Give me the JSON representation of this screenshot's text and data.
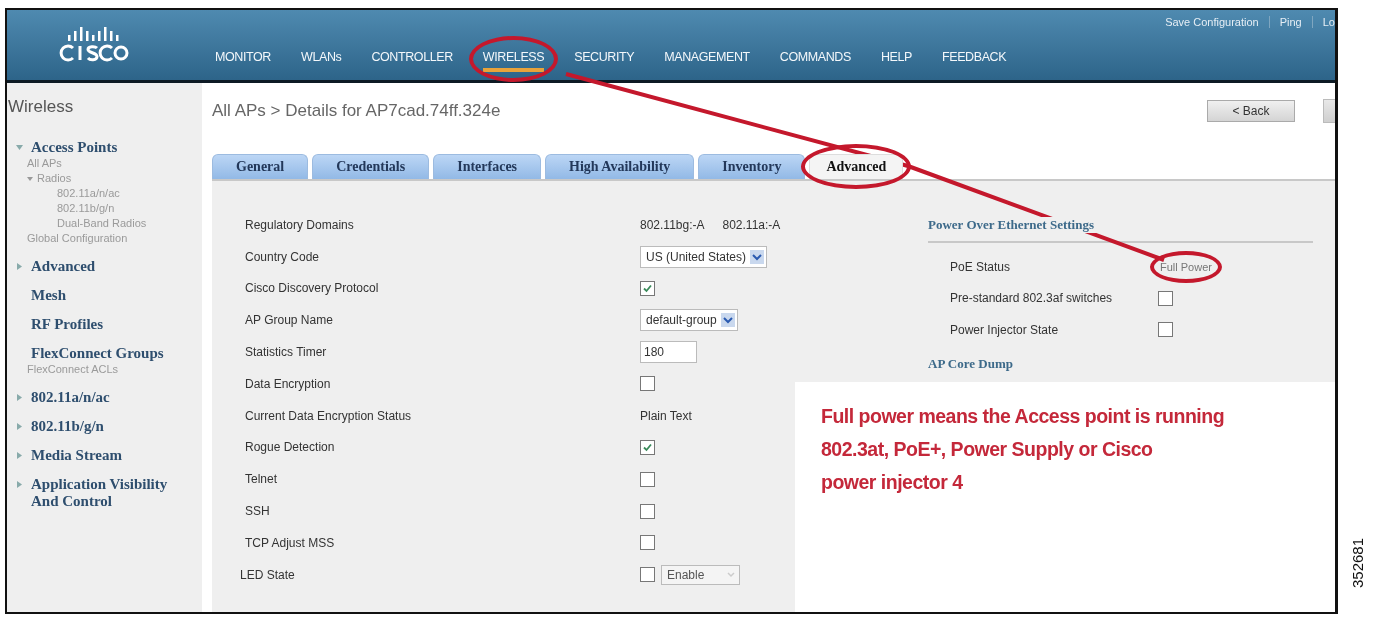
{
  "header": {
    "top_links": [
      "Save Configuration",
      "Ping",
      "Lo"
    ],
    "nav": [
      {
        "label": "MONITOR",
        "selected": false,
        "highlighted": false
      },
      {
        "label": "WLANs",
        "selected": false,
        "highlighted": false
      },
      {
        "label": "CONTROLLER",
        "selected": false,
        "highlighted": false
      },
      {
        "label": "WIRELESS",
        "selected": true,
        "highlighted": true
      },
      {
        "label": "SECURITY",
        "selected": false,
        "highlighted": false
      },
      {
        "label": "MANAGEMENT",
        "selected": false,
        "highlighted": false
      },
      {
        "label": "COMMANDS",
        "selected": false,
        "highlighted": false
      },
      {
        "label": "HELP",
        "selected": false,
        "highlighted": false
      },
      {
        "label": "FEEDBACK",
        "selected": false,
        "highlighted": false
      }
    ]
  },
  "sidebar": {
    "title": "Wireless",
    "items": [
      {
        "label": "Access Points",
        "expanded": true,
        "children": [
          {
            "label": "All APs"
          },
          {
            "label": "Radios",
            "expanded": true,
            "children": [
              {
                "label": "802.11a/n/ac"
              },
              {
                "label": "802.11b/g/n"
              },
              {
                "label": "Dual-Band Radios"
              }
            ]
          },
          {
            "label": "Global Configuration"
          }
        ]
      },
      {
        "label": "Advanced",
        "expanded": false
      },
      {
        "label": "Mesh"
      },
      {
        "label": "RF Profiles"
      },
      {
        "label": "FlexConnect Groups",
        "children": [
          {
            "label": "FlexConnect ACLs"
          }
        ]
      },
      {
        "label": "802.11a/n/ac",
        "expanded": false
      },
      {
        "label": "802.11b/g/n",
        "expanded": false
      },
      {
        "label": "Media Stream",
        "expanded": false
      },
      {
        "label": "Application Visibility And Control",
        "expanded": false
      }
    ]
  },
  "page": {
    "breadcrumb": "All APs > Details for AP7cad.74ff.324e",
    "back_button": "< Back"
  },
  "tabs": [
    {
      "label": "General",
      "selected": false,
      "highlighted": false
    },
    {
      "label": "Credentials",
      "selected": false,
      "highlighted": false
    },
    {
      "label": "Interfaces",
      "selected": false,
      "highlighted": false
    },
    {
      "label": "High Availability",
      "selected": false,
      "highlighted": false
    },
    {
      "label": "Inventory",
      "selected": false,
      "highlighted": false
    },
    {
      "label": "Advanced",
      "selected": true,
      "highlighted": true
    }
  ],
  "fields": [
    {
      "kind": "text",
      "label": "Regulatory Domains",
      "values": [
        "802.11bg:-A",
        "802.11a:-A"
      ]
    },
    {
      "kind": "select",
      "label": "Country Code",
      "value": "US (United States)"
    },
    {
      "kind": "checkbox",
      "label": "Cisco Discovery Protocol",
      "checked": true
    },
    {
      "kind": "select",
      "label": "AP Group Name",
      "value": "default-group"
    },
    {
      "kind": "input",
      "label": "Statistics Timer",
      "value": "180"
    },
    {
      "kind": "checkbox",
      "label": "Data Encryption",
      "checked": false
    },
    {
      "kind": "text",
      "label": "Current Data Encryption Status",
      "values": [
        "Plain Text"
      ]
    },
    {
      "kind": "checkbox",
      "label": "Rogue Detection",
      "checked": true
    },
    {
      "kind": "checkbox",
      "label": "Telnet",
      "checked": false
    },
    {
      "kind": "checkbox",
      "label": "SSH",
      "checked": false
    },
    {
      "kind": "checkbox",
      "label": "TCP Adjust MSS",
      "checked": false
    },
    {
      "kind": "checkbox_select",
      "label": "LED State",
      "checked": false,
      "value": "Enable",
      "disabled": true
    }
  ],
  "poe": {
    "title": "Power Over Ethernet Settings",
    "rows": [
      {
        "kind": "text",
        "label": "PoE Status",
        "value": "Full Power",
        "highlighted": true
      },
      {
        "kind": "checkbox",
        "label": "Pre-standard 802.3af switches",
        "checked": false,
        "highlighted": false
      },
      {
        "kind": "checkbox",
        "label": "Power Injector State",
        "checked": false,
        "highlighted": false
      }
    ]
  },
  "core_dump": {
    "title": "AP Core Dump"
  },
  "callout": {
    "lines": [
      "Full power means the Access point is running",
      "802.3at, PoE+, Power Supply or Cisco",
      "power injector 4"
    ]
  },
  "figure_number": "352681"
}
